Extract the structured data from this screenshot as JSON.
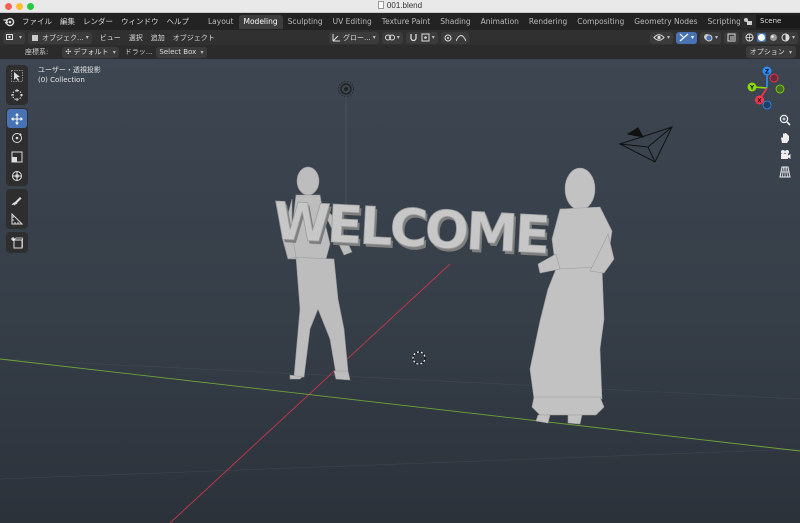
{
  "window": {
    "title": "001.blend"
  },
  "menu": [
    "ファイル",
    "編集",
    "レンダー",
    "ウィンドウ",
    "ヘルプ"
  ],
  "workspaces": [
    "Layout",
    "Modeling",
    "Sculpting",
    "UV Editing",
    "Texture Paint",
    "Shading",
    "Animation",
    "Rendering",
    "Compositing",
    "Geometry Nodes",
    "Scripting"
  ],
  "active_workspace": "Modeling",
  "scene": {
    "name": "Scene"
  },
  "header": {
    "mode": "オブジェク...",
    "view": "ビュー",
    "select": "選択",
    "add": "追加",
    "object": "オブジェクト",
    "transform_orientation": "グロー..."
  },
  "tool_settings": {
    "coord_label": "座標系:",
    "coord_value": "デフォルト",
    "drag_label": "ドラッ...",
    "drag_value": "Select Box",
    "options": "オプション"
  },
  "viewport": {
    "view_name": "ユーザー・透視投影",
    "collection": "(0) Collection",
    "sign_text": "WELCOME",
    "gizmo_axes": [
      "X",
      "Y",
      "Z"
    ]
  },
  "colors": {
    "accent": "#4772b3",
    "axis_x": "#ff3352",
    "axis_y": "#8bdc00",
    "axis_z": "#2890ff"
  }
}
